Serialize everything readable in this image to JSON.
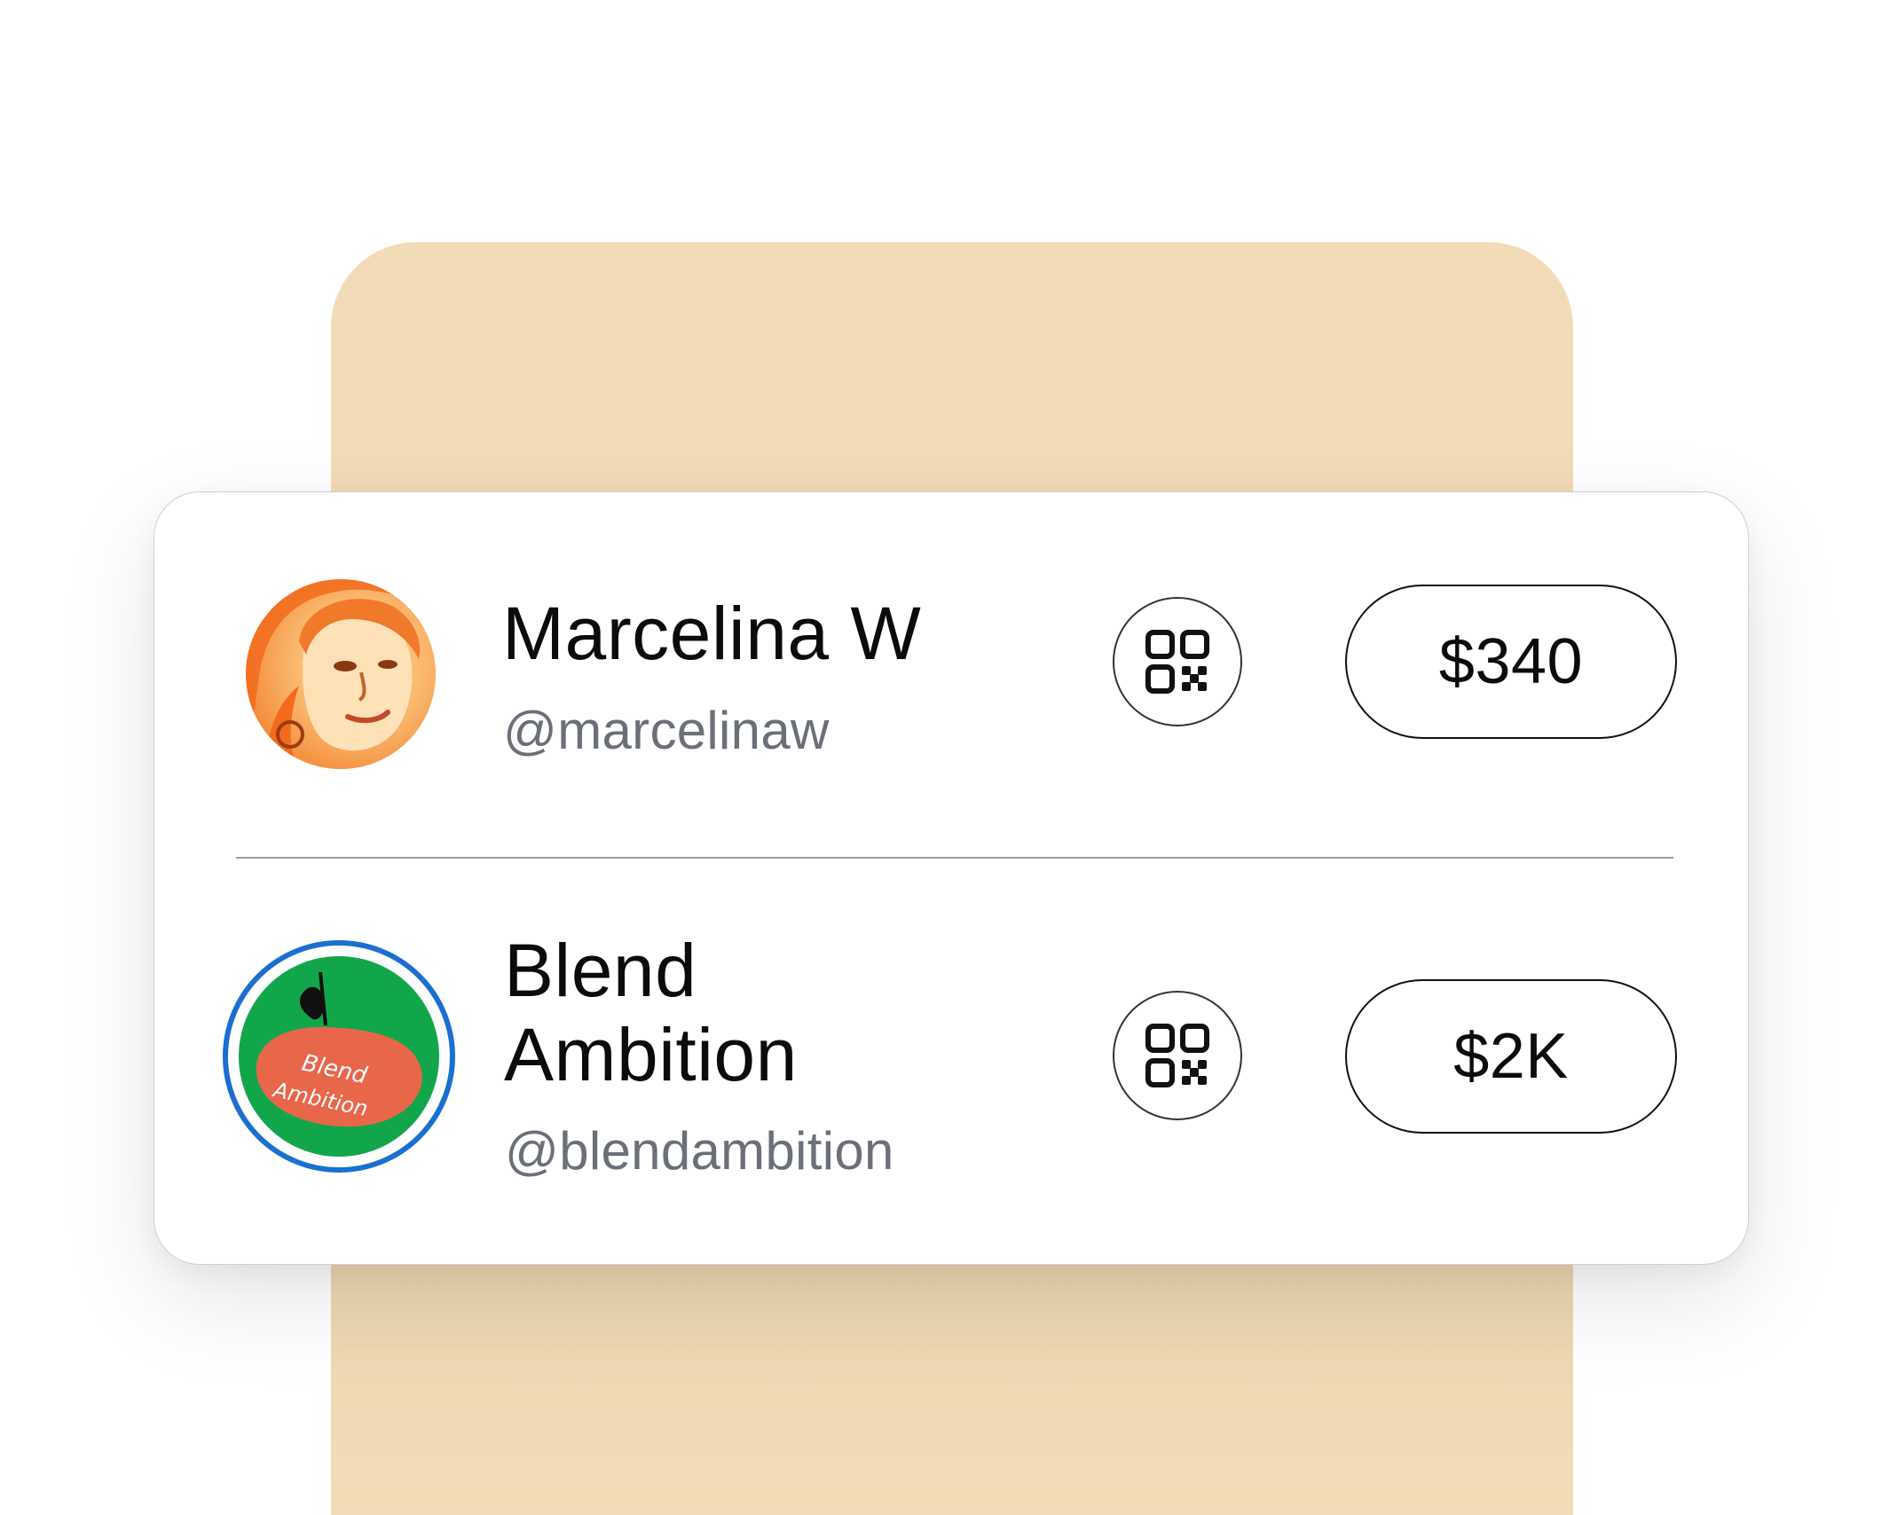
{
  "people": [
    {
      "name": "Marcelina W",
      "handle": "@marcelinaw",
      "amount": "$340",
      "qr_icon": "qr-code-icon"
    },
    {
      "name": "Blend Ambition",
      "handle": "@blendambition",
      "amount": "$2K",
      "qr_icon": "qr-code-icon",
      "logo_text": "Blend Ambition"
    }
  ],
  "colors": {
    "backdrop": "#f2dcb7",
    "card": "#ffffff",
    "handle_text": "#6b6f78",
    "blend_logo_green": "#12a64a",
    "blend_logo_ring": "#1a6fd0",
    "blend_logo_apple": "#e8664a",
    "marcelina_avatar_tint": "#f48433"
  }
}
